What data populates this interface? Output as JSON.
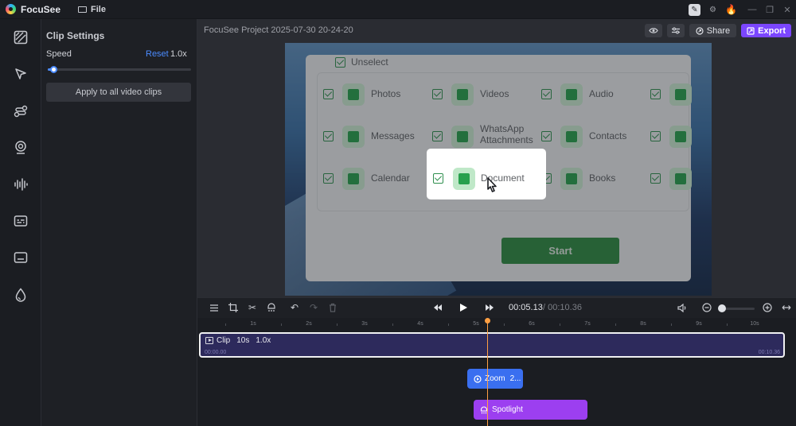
{
  "titlebar": {
    "app_name": "FocuSee",
    "file_menu": "File"
  },
  "sidebar": {
    "items": [
      {
        "name": "background-icon"
      },
      {
        "name": "cursor-icon"
      },
      {
        "name": "path-icon"
      },
      {
        "name": "camera-icon"
      },
      {
        "name": "audio-icon"
      },
      {
        "name": "captions-icon"
      },
      {
        "name": "annotation-icon"
      },
      {
        "name": "watermark-icon"
      }
    ]
  },
  "clip_settings": {
    "title": "Clip Settings",
    "speed_label": "Speed",
    "reset_label": "Reset",
    "speed_value": "1.0x",
    "speed_fraction": 0.04,
    "apply_label": "Apply to all video clips"
  },
  "main": {
    "project_title": "FocuSee Project 2025-07-30 20-24-20",
    "share_label": "Share",
    "export_label": "Export"
  },
  "preview": {
    "unselect_label": "Unselect",
    "categories": [
      "Photos",
      "Videos",
      "Audio",
      "Messages",
      "WhatsApp\nAttachments",
      "Contacts",
      "Calendar",
      "Document",
      "Books"
    ],
    "start_label": "Start"
  },
  "controls": {
    "time_current": "00:05.13",
    "time_total": "/ 00:10.36"
  },
  "timeline": {
    "ticks": [
      "1s",
      "2s",
      "3s",
      "4s",
      "5s",
      "6s",
      "7s",
      "8s",
      "9s",
      "10s"
    ],
    "clip_label": "Clip",
    "clip_duration": "10s",
    "clip_speed": "1.0x",
    "clip_start": "00:00.00",
    "clip_end": "00:10.36",
    "zoom_label": "Zoom",
    "zoom_value": "2...",
    "spotlight_label": "Spotlight"
  },
  "colors": {
    "accent": "#4b8bff",
    "export": "#7b46ff",
    "zoom": "#3a6ff0",
    "spotlight": "#9c3ff0",
    "playhead": "#ff9f43"
  }
}
